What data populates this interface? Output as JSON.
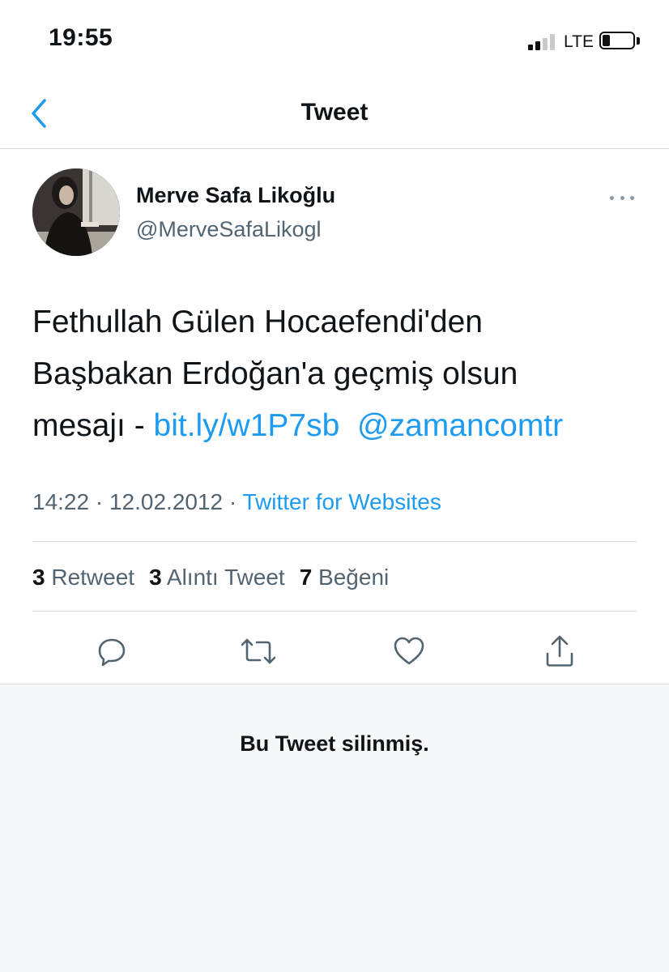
{
  "status_bar": {
    "time": "19:55",
    "network": "LTE",
    "battery_level": 0.25,
    "icons": [
      "signal-icon",
      "battery-icon"
    ]
  },
  "header": {
    "title": "Tweet",
    "back_icon": "chevron-left-icon",
    "accent_color": "#1d9bf0"
  },
  "tweet": {
    "author_name": "Merve Safa Likoğlu",
    "author_handle": "@MerveSafaLikogl",
    "more_icon": "more-icon",
    "text_line1": "Fethullah Gülen Hocaefendi'den",
    "text_line2": "Başbakan Erdoğan'a geçmiş olsun",
    "text_line3": "mesajı - ",
    "link": "bit.ly/w1P7sb",
    "mention": "@zamancomtr",
    "time": "14:22",
    "date": "12.02.2012",
    "separator": "·",
    "source": "Twitter for Websites",
    "stats": [
      {
        "count": "3",
        "label": "Retweet"
      },
      {
        "count": "3",
        "label": "Alıntı Tweet"
      },
      {
        "count": "7",
        "label": "Beğeni"
      }
    ],
    "actions": [
      "reply-icon",
      "retweet-icon",
      "like-icon",
      "share-icon"
    ]
  },
  "deleted_notice": "Bu Tweet silinmiş."
}
